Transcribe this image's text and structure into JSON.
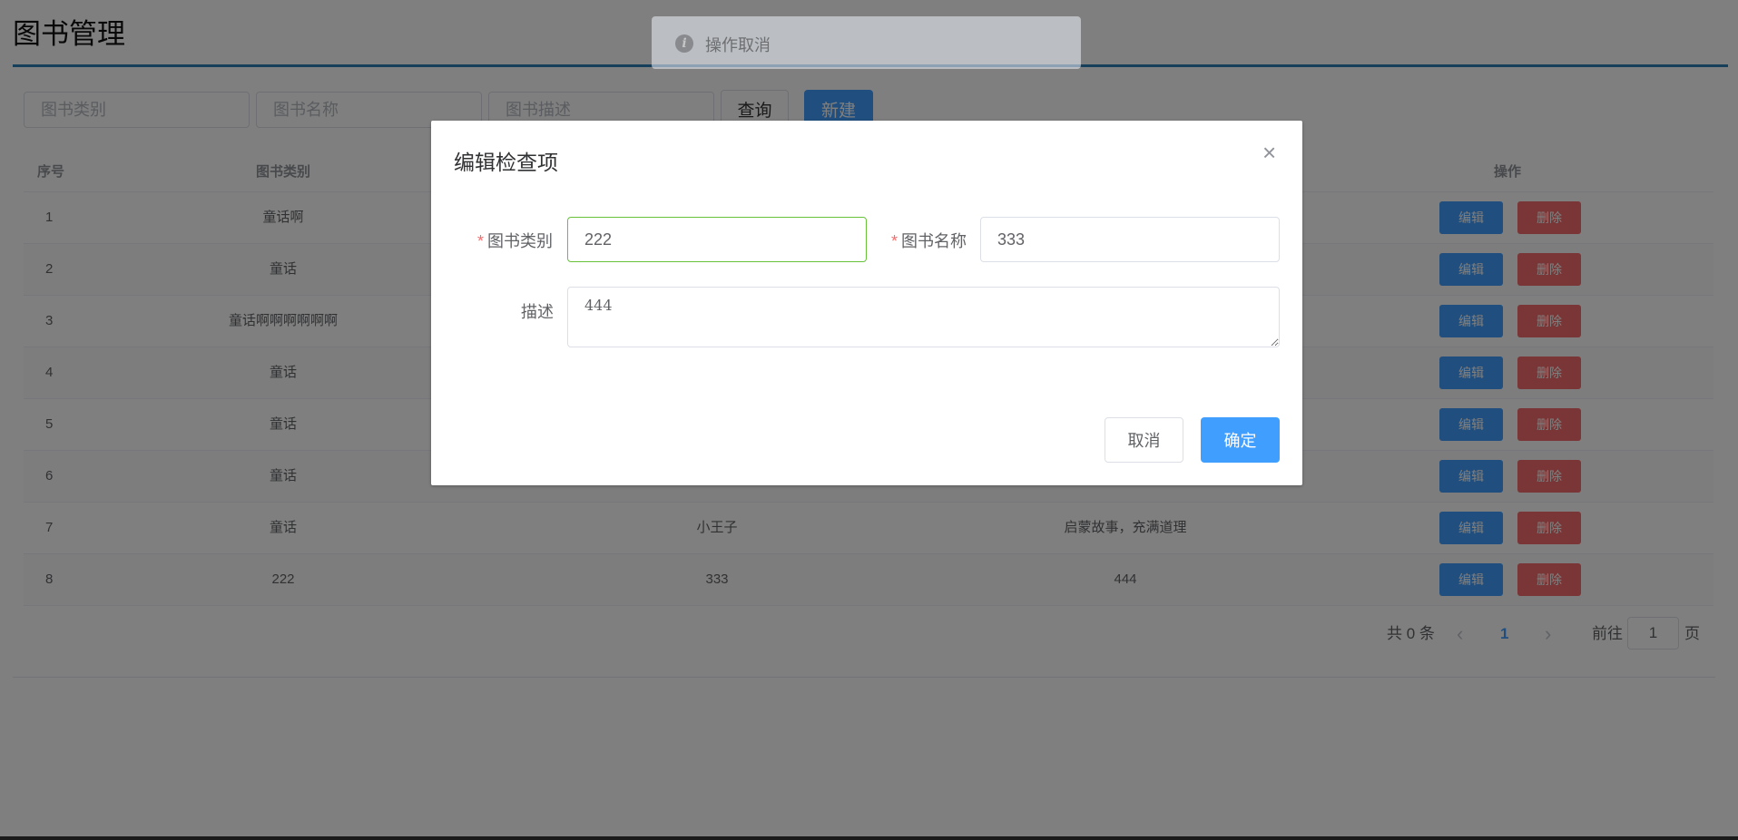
{
  "page": {
    "title": "图书管理"
  },
  "filters": {
    "category_placeholder": "图书类别",
    "name_placeholder": "图书名称",
    "desc_placeholder": "图书描述",
    "query_label": "查询",
    "new_label": "新建"
  },
  "table": {
    "headers": {
      "index": "序号",
      "category": "图书类别",
      "operations": "操作"
    },
    "rows": [
      {
        "index": "1",
        "category": "童话啊",
        "name": "",
        "desc": "",
        "edit": "编辑",
        "delete": "删除"
      },
      {
        "index": "2",
        "category": "童话",
        "name": "",
        "desc": "",
        "edit": "编辑",
        "delete": "删除"
      },
      {
        "index": "3",
        "category": "童话啊啊啊啊啊啊",
        "name": "",
        "desc": "",
        "edit": "编辑",
        "delete": "删除"
      },
      {
        "index": "4",
        "category": "童话",
        "name": "",
        "desc": "",
        "edit": "编辑",
        "delete": "删除"
      },
      {
        "index": "5",
        "category": "童话",
        "name": "",
        "desc": "",
        "edit": "编辑",
        "delete": "删除"
      },
      {
        "index": "6",
        "category": "童话",
        "name": "",
        "desc": "",
        "edit": "编辑",
        "delete": "删除"
      },
      {
        "index": "7",
        "category": "童话",
        "name": "小王子",
        "desc": "启蒙故事，充满道理",
        "edit": "编辑",
        "delete": "删除"
      },
      {
        "index": "8",
        "category": "222",
        "name": "333",
        "desc": "444",
        "edit": "编辑",
        "delete": "删除"
      }
    ]
  },
  "pagination": {
    "total_text": "共 0 条",
    "prev_icon": "‹",
    "current_page": "1",
    "next_icon": "›",
    "goto_label": "前往",
    "goto_value": "1",
    "page_suffix": "页"
  },
  "toast": {
    "icon": "i",
    "message": "操作取消"
  },
  "dialog": {
    "title": "编辑检查项",
    "close_icon": "×",
    "category_label": "图书类别",
    "category_value": "222",
    "name_label": "图书名称",
    "name_value": "333",
    "desc_label": "描述",
    "desc_value": "444",
    "required_mark": "*",
    "cancel_label": "取消",
    "ok_label": "确定"
  },
  "colors": {
    "primary": "#409eff",
    "danger": "#f56c6c",
    "success": "#67c23a",
    "title_rule": "#2d7fb8"
  }
}
